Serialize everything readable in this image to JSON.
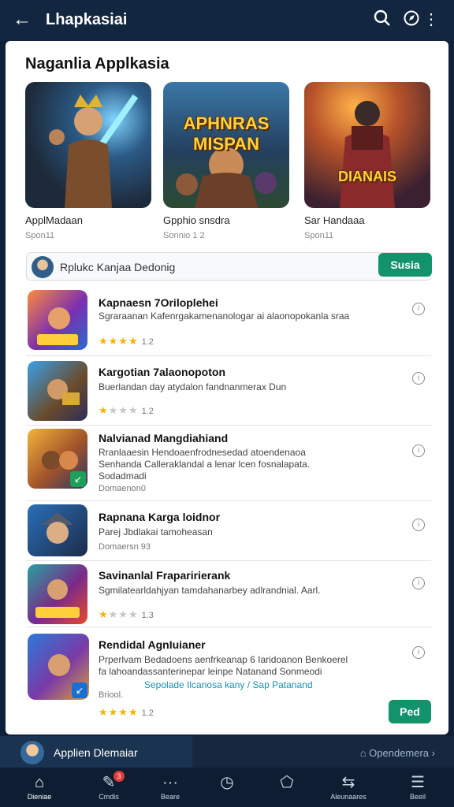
{
  "header": {
    "back_icon": "arrow-left-icon",
    "title": "Lhapkasiai",
    "icons": [
      "search-icon",
      "compass-icon",
      "more-vert-icon"
    ]
  },
  "featured": {
    "title": "Naganlia Applkasia",
    "items": [
      {
        "name": "ApplMadaan",
        "sub": "Spon11",
        "overlay": ""
      },
      {
        "name": "Gpphio snsdra",
        "sub": "Sonnio 1 2",
        "overlay": "APHNRAS MISPAN"
      },
      {
        "name": "Sar Handaaa",
        "sub": "Spon11",
        "overlay": "DIANAIS"
      }
    ]
  },
  "banner": {
    "text": "Rplukc Kanjaa Dedonig",
    "button": "Susia"
  },
  "list": [
    {
      "title": "Kapnaesn 7Oriloplehei",
      "desc": "Sgraraanan Kafenrgakamenanologar ai alaonopokanla sraa",
      "meta": "",
      "rating": "1.2",
      "stars": 4
    },
    {
      "title": "Kargotian 7alaonopoton",
      "desc": "Buerlandan day atydalon fandnanmerax Dun",
      "meta": "",
      "rating": "1.2",
      "stars": 1
    },
    {
      "title": "Nalvianad Mangdiahiand",
      "desc": "Rranlaaesin Hendoaenfrodnesedad atoendenaoa Senhanda Calleraklandal a lenar lcen fosnalapata. Sodadmadi",
      "meta": "Domaenon0",
      "rating": "",
      "stars": 0
    },
    {
      "title": "Rapnana Karga loidnor",
      "desc": "Parej Jbdlakai tamoheasan",
      "meta": "Domaersn 93",
      "rating": "",
      "stars": 0
    },
    {
      "title": "Savinanlal Fraparirierank",
      "desc": "Sgmilatearldahjyan tamdahanarbey adlrandnial. Aarl.",
      "meta": "",
      "rating": "1.3",
      "stars": 1
    },
    {
      "title": "Rendidal AgnIuianer",
      "desc": "Prperlvam Bedadoens aenfrkeanap 6 Iaridoanon Benkoerel fa lahoandassanterinepar leinpe Natanand Sonmeodi",
      "link": "Sepolade Ilcanosa kany / Sap Patanand",
      "meta": "Briool.",
      "rating": "1.2",
      "stars": 4,
      "button": "Ped"
    }
  ],
  "bottom_strip": {
    "label": "Applien Dlemaiar",
    "right": "Opendemera"
  },
  "tabbar": [
    {
      "label": "Dieniae",
      "icon": "home-icon"
    },
    {
      "label": "Cmdis",
      "icon": "edit-icon",
      "badge": "3"
    },
    {
      "label": "Beare",
      "icon": "dots-icon"
    },
    {
      "label": "",
      "icon": "compass-icon"
    },
    {
      "label": "",
      "icon": "tag-icon"
    },
    {
      "label": "Aleunaares",
      "icon": "share-icon"
    },
    {
      "label": "Beeil",
      "icon": "menu-icon"
    }
  ],
  "colors": {
    "accent": "#13936a",
    "topbar": "#13263f",
    "star": "#f5b301"
  }
}
